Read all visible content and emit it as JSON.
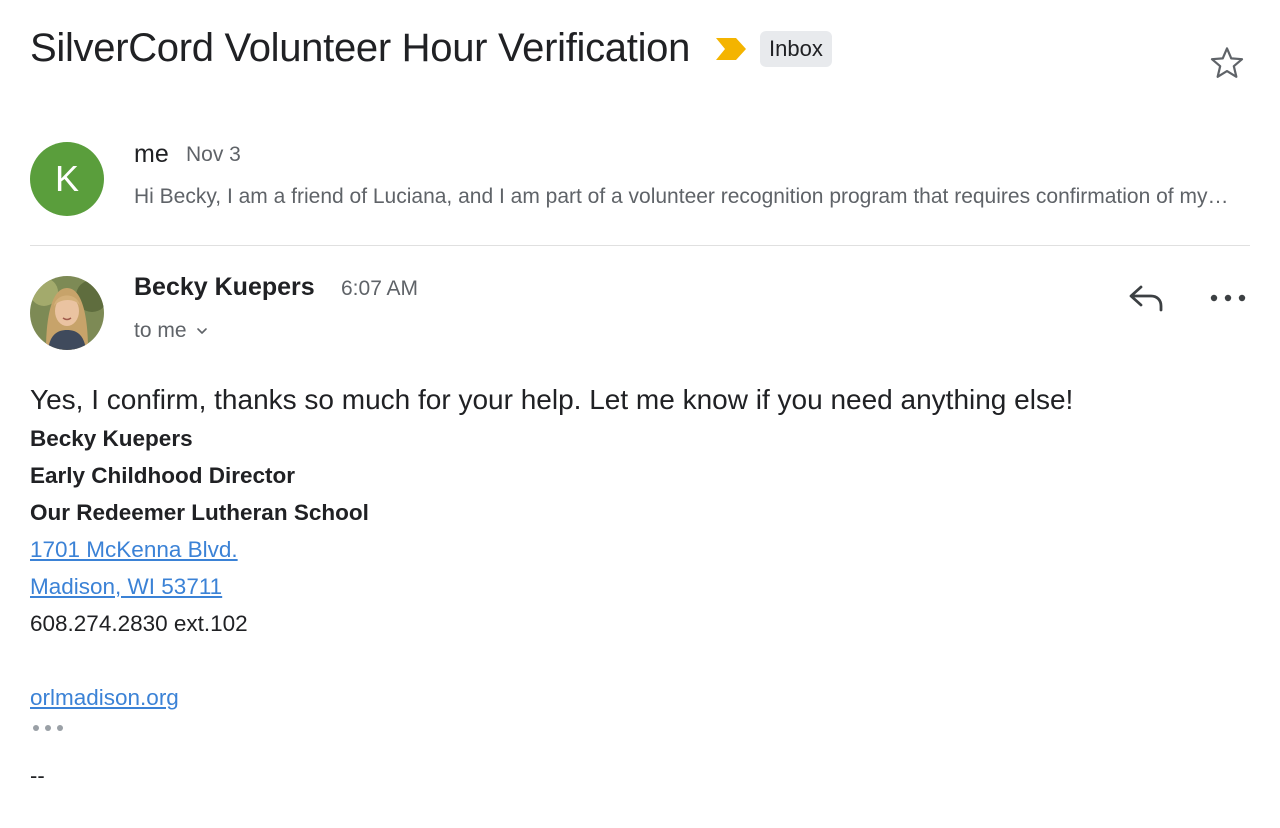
{
  "thread": {
    "subject": "SilverCord Volunteer Hour Verification",
    "label": "Inbox",
    "colors": {
      "importance": "#f4b400",
      "avatar_k": "#5a9e3c",
      "link": "#3b82d6"
    }
  },
  "message1": {
    "avatar_letter": "K",
    "from": "me",
    "date": "Nov 3",
    "snippet": "Hi Becky, I am a friend of Luciana, and I am part of a volunteer recognition program that requires confirmation of my volunteer hours"
  },
  "message2": {
    "sender": "Becky Kuepers",
    "time": "6:07 AM",
    "to": "to me",
    "body": "Yes, I confirm, thanks so much for your help. Let me know if you need anything else!",
    "signature": {
      "name": "Becky Kuepers",
      "title": "Early Childhood Director",
      "org": "Our Redeemer Lutheran School",
      "address1": "1701 McKenna Blvd.",
      "address2": "Madison, WI 53711",
      "phone": "608.274.2830 ext.102",
      "website": "orlmadison.org"
    },
    "separator": "--"
  },
  "icons": [
    "importance-marker-icon",
    "star-icon",
    "reply-icon",
    "more-options-icon",
    "chevron-down-icon",
    "show-trimmed-content-icon"
  ]
}
